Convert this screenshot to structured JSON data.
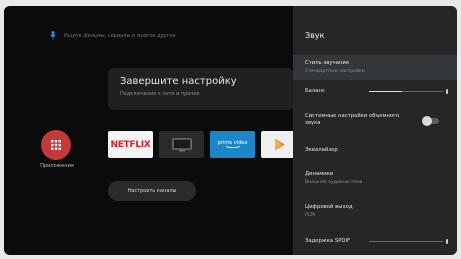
{
  "search": {
    "placeholder": "Ищите фильмы, сериалы и многое другое"
  },
  "setup_card": {
    "title": "Завершите настройку",
    "subtitle": "Подключение к сети и прочее"
  },
  "apps": {
    "label": "Приложения"
  },
  "app_row": [
    {
      "name": "netflix",
      "label": "NETFLIX"
    },
    {
      "name": "tv",
      "label": ""
    },
    {
      "name": "prime-video",
      "label": "prime video"
    },
    {
      "name": "google-play",
      "label": ""
    }
  ],
  "camera_button": {
    "label": "Настроить каналы"
  },
  "panel": {
    "title": "Звук",
    "items": [
      {
        "label": "Стиль звучания",
        "sub": "Стандартные настройки"
      },
      {
        "label": "Баланс",
        "value": 0.45
      },
      {
        "label": "Системные настройки объемного звука",
        "toggle": false
      },
      {
        "label": "Эквалайзер"
      },
      {
        "label": "Динамики",
        "sub": "Внешняя аудиосистема"
      },
      {
        "label": "Цифровой выход",
        "sub": "PCM"
      },
      {
        "label": "Задержка SPDIF",
        "value": 0.0
      }
    ]
  },
  "colors": {
    "accent_red": "#c33a38",
    "panel_bg": "#242628",
    "netflix_red": "#e21c24",
    "prime_blue": "#1d86c8"
  }
}
